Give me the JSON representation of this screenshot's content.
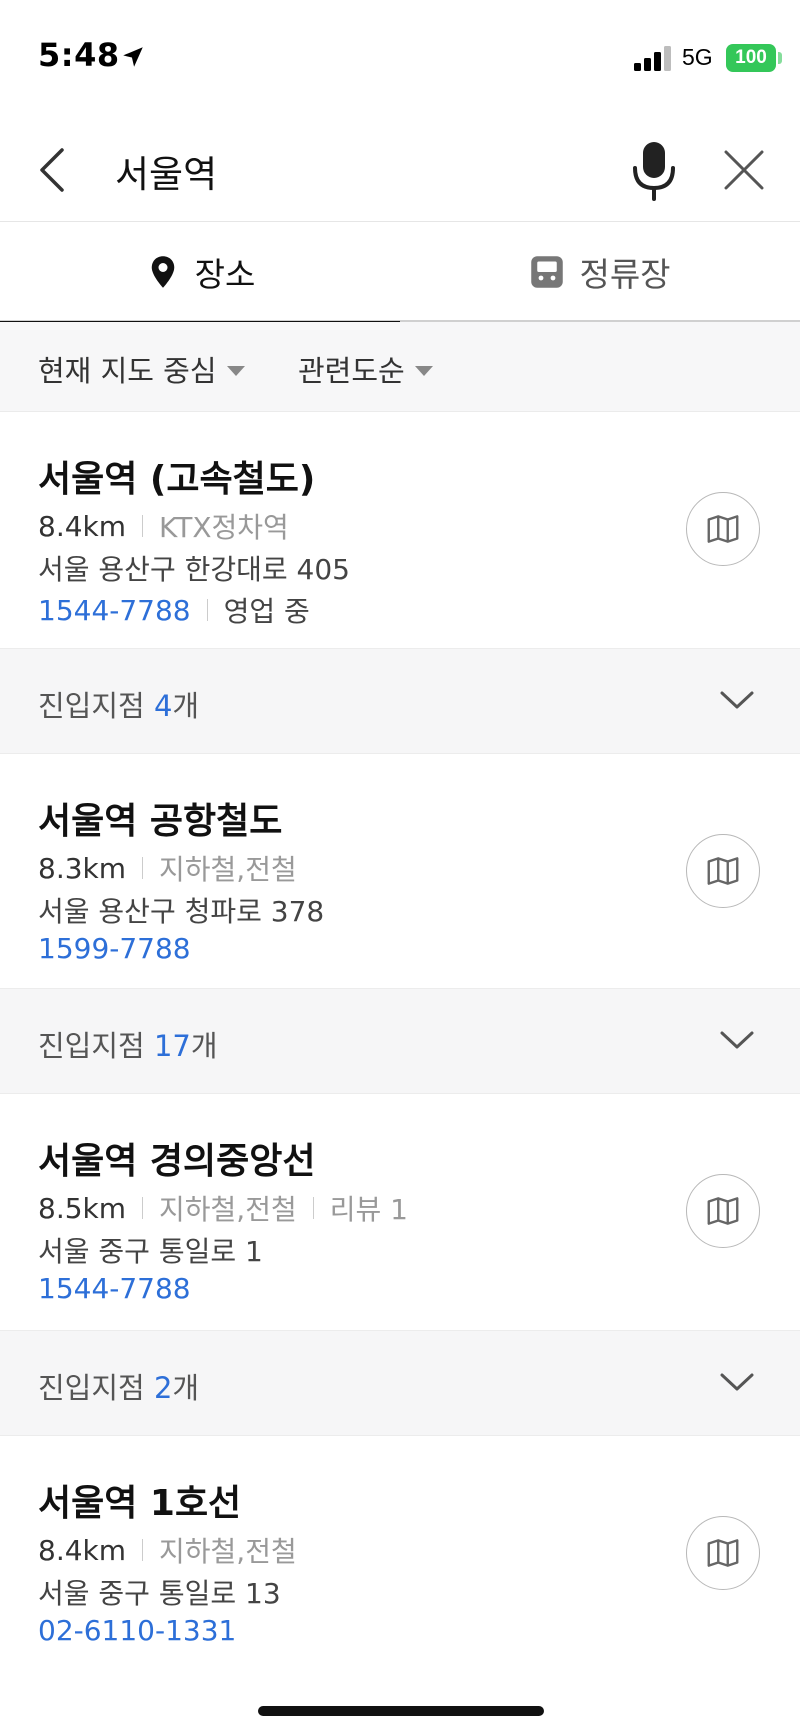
{
  "status_bar": {
    "time": "5:48",
    "network": "5G",
    "battery": "100"
  },
  "search": {
    "query": "서울역"
  },
  "tabs": [
    {
      "label": "장소",
      "icon": "location-pin-icon"
    },
    {
      "label": "정류장",
      "icon": "bus-icon"
    }
  ],
  "filters": {
    "center": "현재 지도 중심",
    "sort": "관련도순"
  },
  "results": [
    {
      "title": "서울역 (고속철도)",
      "distance": "8.4km",
      "category": "KTX정차역",
      "address": "서울 용산구 한강대로 405",
      "phone": "1544-7788",
      "status": "영업 중",
      "entry_label": "진입지점",
      "entry_count": "4",
      "entry_suffix": "개"
    },
    {
      "title": "서울역 공항철도",
      "distance": "8.3km",
      "category": "지하철,전철",
      "address": "서울 용산구 청파로 378",
      "phone": "1599-7788",
      "entry_label": "진입지점",
      "entry_count": "17",
      "entry_suffix": "개"
    },
    {
      "title": "서울역 경의중앙선",
      "distance": "8.5km",
      "category": "지하철,전철",
      "review": "리뷰 1",
      "address": "서울 중구 통일로 1",
      "phone": "1544-7788",
      "entry_label": "진입지점",
      "entry_count": "2",
      "entry_suffix": "개"
    },
    {
      "title": "서울역 1호선",
      "distance": "8.4km",
      "category": "지하철,전철",
      "address": "서울 중구 통일로 13",
      "phone": "02-6110-1331"
    }
  ],
  "colors": {
    "accent_blue": "#2d6fd8",
    "battery_green": "#34c759"
  }
}
